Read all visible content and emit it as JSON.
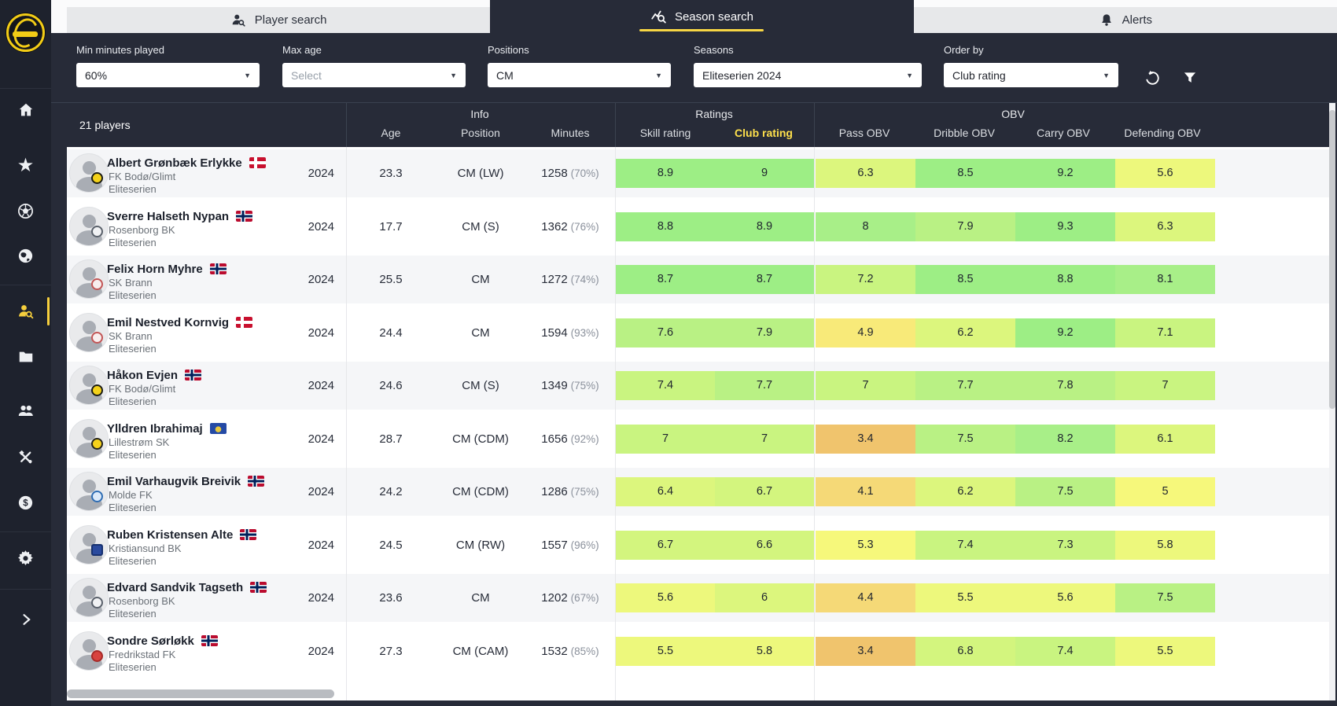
{
  "sidebar": {
    "logo_title": "FK Bodø/Glimt crest",
    "items": [
      {
        "id": "home",
        "icon": "home-icon",
        "active": false
      },
      {
        "id": "favorites",
        "icon": "star-icon",
        "active": false
      },
      {
        "id": "football",
        "icon": "football-icon",
        "active": false
      },
      {
        "id": "world",
        "icon": "globe-icon",
        "active": false
      },
      {
        "id": "player-search",
        "icon": "player-search-icon",
        "active": true
      },
      {
        "id": "files",
        "icon": "folder-icon",
        "active": false
      },
      {
        "id": "squad",
        "icon": "people-icon",
        "active": false
      },
      {
        "id": "tools",
        "icon": "tools-icon",
        "active": false
      },
      {
        "id": "finance",
        "icon": "dollar-icon",
        "active": false
      },
      {
        "id": "settings",
        "icon": "gear-icon",
        "active": false
      },
      {
        "id": "expand",
        "icon": "chevron-right-icon",
        "active": false
      }
    ]
  },
  "tabs": [
    {
      "id": "player-search",
      "label": "Player search",
      "icon": "person-search-icon",
      "active": false
    },
    {
      "id": "season-search",
      "label": "Season search",
      "icon": "chart-search-icon",
      "active": true
    },
    {
      "id": "alerts",
      "label": "Alerts",
      "icon": "bell-icon",
      "active": false
    }
  ],
  "filters": [
    {
      "id": "min-minutes",
      "label": "Min minutes played",
      "value": "60%",
      "placeholder": ""
    },
    {
      "id": "max-age",
      "label": "Max age",
      "value": "",
      "placeholder": "Select"
    },
    {
      "id": "positions",
      "label": "Positions",
      "value": "CM",
      "placeholder": ""
    },
    {
      "id": "seasons",
      "label": "Seasons",
      "value": "Eliteserien 2024",
      "placeholder": ""
    },
    {
      "id": "order-by",
      "label": "Order by",
      "value": "Club rating",
      "placeholder": ""
    }
  ],
  "table": {
    "count_label": "21 players",
    "column_groups": [
      {
        "label": "Info",
        "columns": [
          "Age",
          "Position",
          "Minutes"
        ]
      },
      {
        "label": "Ratings",
        "columns": [
          "Skill rating",
          "Club rating"
        ]
      },
      {
        "label": "OBV",
        "columns": [
          "Pass OBV",
          "Dribble OBV",
          "Carry OBV",
          "Defending OBV"
        ]
      }
    ],
    "sorted_column": "Club rating",
    "rows": [
      {
        "name": "Albert Grønbæk Erlykke",
        "nationality": "dk",
        "club": "FK Bodø/Glimt",
        "league": "Eliteserien",
        "season": "2024",
        "age": "23.3",
        "position": "CM (LW)",
        "minutes": "1258",
        "minutes_pct": "(70%)",
        "badge": {
          "bg": "#f4d21a",
          "border": "#1a1b14",
          "shape": "circle"
        },
        "values": {
          "skill": "8.9",
          "club": "9",
          "pass": "6.3",
          "dribble": "8.5",
          "carry": "9.2",
          "defending": "5.6"
        }
      },
      {
        "name": "Sverre Halseth Nypan",
        "nationality": "no",
        "club": "Rosenborg BK",
        "league": "Eliteserien",
        "season": "2024",
        "age": "17.7",
        "position": "CM (S)",
        "minutes": "1362",
        "minutes_pct": "(76%)",
        "badge": {
          "bg": "#f1f2f4",
          "border": "#59606a",
          "shape": "circle"
        },
        "values": {
          "skill": "8.8",
          "club": "8.9",
          "pass": "8",
          "dribble": "7.9",
          "carry": "9.3",
          "defending": "6.3"
        }
      },
      {
        "name": "Felix Horn Myhre",
        "nationality": "no",
        "club": "SK Brann",
        "league": "Eliteserien",
        "season": "2024",
        "age": "25.5",
        "position": "CM",
        "minutes": "1272",
        "minutes_pct": "(74%)",
        "badge": {
          "bg": "#f8eeee",
          "border": "#c25555",
          "shape": "circle"
        },
        "values": {
          "skill": "8.7",
          "club": "8.7",
          "pass": "7.2",
          "dribble": "8.5",
          "carry": "8.8",
          "defending": "8.1"
        }
      },
      {
        "name": "Emil Nestved Kornvig",
        "nationality": "dk",
        "club": "SK Brann",
        "league": "Eliteserien",
        "season": "2024",
        "age": "24.4",
        "position": "CM",
        "minutes": "1594",
        "minutes_pct": "(93%)",
        "badge": {
          "bg": "#f8eeee",
          "border": "#c25555",
          "shape": "circle"
        },
        "values": {
          "skill": "7.6",
          "club": "7.9",
          "pass": "4.9",
          "dribble": "6.2",
          "carry": "9.2",
          "defending": "7.1"
        }
      },
      {
        "name": "Håkon Evjen",
        "nationality": "no",
        "club": "FK Bodø/Glimt",
        "league": "Eliteserien",
        "season": "2024",
        "age": "24.6",
        "position": "CM (S)",
        "minutes": "1349",
        "minutes_pct": "(75%)",
        "badge": {
          "bg": "#f4d21a",
          "border": "#1a1b14",
          "shape": "circle"
        },
        "values": {
          "skill": "7.4",
          "club": "7.7",
          "pass": "7",
          "dribble": "7.7",
          "carry": "7.8",
          "defending": "7"
        }
      },
      {
        "name": "Ylldren Ibrahimaj",
        "nationality": "xk",
        "club": "Lillestrøm SK",
        "league": "Eliteserien",
        "season": "2024",
        "age": "28.7",
        "position": "CM (CDM)",
        "minutes": "1656",
        "minutes_pct": "(92%)",
        "badge": {
          "bg": "#f6d21c",
          "border": "#23231c",
          "shape": "circle"
        },
        "values": {
          "skill": "7",
          "club": "7",
          "pass": "3.4",
          "dribble": "7.5",
          "carry": "8.2",
          "defending": "6.1"
        }
      },
      {
        "name": "Emil Varhaugvik Breivik",
        "nationality": "no",
        "club": "Molde FK",
        "league": "Eliteserien",
        "season": "2024",
        "age": "24.2",
        "position": "CM (CDM)",
        "minutes": "1286",
        "minutes_pct": "(75%)",
        "badge": {
          "bg": "#ddeaf9",
          "border": "#2d6cb3",
          "shape": "circle"
        },
        "values": {
          "skill": "6.4",
          "club": "6.7",
          "pass": "4.1",
          "dribble": "6.2",
          "carry": "7.5",
          "defending": "5"
        }
      },
      {
        "name": "Ruben Kristensen Alte",
        "nationality": "no",
        "club": "Kristiansund BK",
        "league": "Eliteserien",
        "season": "2024",
        "age": "24.5",
        "position": "CM (RW)",
        "minutes": "1557",
        "minutes_pct": "(96%)",
        "badge": {
          "bg": "#2a4a9e",
          "border": "#17316f",
          "shape": "square"
        },
        "values": {
          "skill": "6.7",
          "club": "6.6",
          "pass": "5.3",
          "dribble": "7.4",
          "carry": "7.3",
          "defending": "5.8"
        }
      },
      {
        "name": "Edvard Sandvik Tagseth",
        "nationality": "no",
        "club": "Rosenborg BK",
        "league": "Eliteserien",
        "season": "2024",
        "age": "23.6",
        "position": "CM",
        "minutes": "1202",
        "minutes_pct": "(67%)",
        "badge": {
          "bg": "#f1f2f4",
          "border": "#59606a",
          "shape": "circle"
        },
        "values": {
          "skill": "5.6",
          "club": "6",
          "pass": "4.4",
          "dribble": "5.5",
          "carry": "5.6",
          "defending": "7.5"
        }
      },
      {
        "name": "Sondre Sørløkk",
        "nationality": "no",
        "club": "Fredrikstad FK",
        "league": "Eliteserien",
        "season": "2024",
        "age": "27.3",
        "position": "CM (CAM)",
        "minutes": "1532",
        "minutes_pct": "(85%)",
        "badge": {
          "bg": "#d8433f",
          "border": "#a62a28",
          "shape": "circle"
        },
        "values": {
          "skill": "5.5",
          "club": "5.8",
          "pass": "3.4",
          "dribble": "6.8",
          "carry": "7.4",
          "defending": "5.5"
        }
      }
    ]
  },
  "colors": {
    "accent_yellow": "#f7d644",
    "sorted_header": "#ffe14c",
    "topbar_bg": "#272b38",
    "sidebar_bg": "#1e222d",
    "row_alt_bg": "#f5f6f8",
    "rating_scale": [
      {
        "min": 8.5,
        "color": "#9dee85"
      },
      {
        "min": 8,
        "color": "#a8ef88"
      },
      {
        "min": 7.5,
        "color": "#b9f184"
      },
      {
        "min": 7,
        "color": "#c9f480"
      },
      {
        "min": 6.5,
        "color": "#d3f57e"
      },
      {
        "min": 6,
        "color": "#dcf67d"
      },
      {
        "min": 5.5,
        "color": "#edf87c"
      },
      {
        "min": 5,
        "color": "#f6f87b"
      },
      {
        "min": 4.5,
        "color": "#f8ea79"
      },
      {
        "min": 4,
        "color": "#f5d977"
      },
      {
        "min": 0,
        "color": "#f0c46d"
      }
    ]
  }
}
